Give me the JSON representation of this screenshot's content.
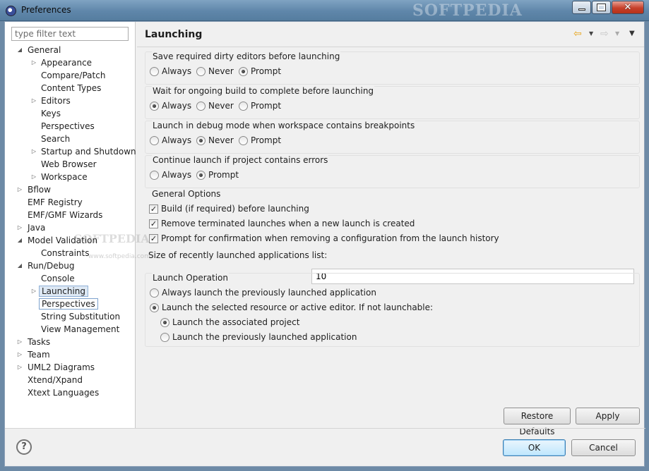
{
  "window": {
    "title": "Preferences",
    "watermark": "SOFTPEDIA",
    "controls": {
      "minimize": "minimize",
      "maximize": "maximize",
      "close": "✕"
    }
  },
  "sidebar": {
    "filter_placeholder": "type filter text",
    "tree": [
      {
        "label": "General",
        "level": 0,
        "arrow": "◢"
      },
      {
        "label": "Appearance",
        "level": 1,
        "arrow": "▷"
      },
      {
        "label": "Compare/Patch",
        "level": 1,
        "arrow": ""
      },
      {
        "label": "Content Types",
        "level": 1,
        "arrow": ""
      },
      {
        "label": "Editors",
        "level": 1,
        "arrow": "▷"
      },
      {
        "label": "Keys",
        "level": 1,
        "arrow": ""
      },
      {
        "label": "Perspectives",
        "level": 1,
        "arrow": ""
      },
      {
        "label": "Search",
        "level": 1,
        "arrow": ""
      },
      {
        "label": "Startup and Shutdown",
        "level": 1,
        "arrow": "▷"
      },
      {
        "label": "Web Browser",
        "level": 1,
        "arrow": ""
      },
      {
        "label": "Workspace",
        "level": 1,
        "arrow": "▷"
      },
      {
        "label": "Bflow",
        "level": 0,
        "arrow": "▷"
      },
      {
        "label": "EMF Registry",
        "level": 0,
        "arrow": ""
      },
      {
        "label": "EMF/GMF Wizards",
        "level": 0,
        "arrow": ""
      },
      {
        "label": "Java",
        "level": 0,
        "arrow": "▷"
      },
      {
        "label": "Model Validation",
        "level": 0,
        "arrow": "◢"
      },
      {
        "label": "Constraints",
        "level": 1,
        "arrow": ""
      },
      {
        "label": "Run/Debug",
        "level": 0,
        "arrow": "◢"
      },
      {
        "label": "Console",
        "level": 1,
        "arrow": ""
      },
      {
        "label": "Launching",
        "level": 1,
        "arrow": "▷",
        "state": "selected"
      },
      {
        "label": "Perspectives",
        "level": 1,
        "arrow": "",
        "state": "focused"
      },
      {
        "label": "String Substitution",
        "level": 1,
        "arrow": ""
      },
      {
        "label": "View Management",
        "level": 1,
        "arrow": ""
      },
      {
        "label": "Tasks",
        "level": 0,
        "arrow": "▷"
      },
      {
        "label": "Team",
        "level": 0,
        "arrow": "▷"
      },
      {
        "label": "UML2 Diagrams",
        "level": 0,
        "arrow": "▷"
      },
      {
        "label": "Xtend/Xpand",
        "level": 0,
        "arrow": ""
      },
      {
        "label": "Xtext Languages",
        "level": 0,
        "arrow": ""
      }
    ]
  },
  "page": {
    "title": "Launching",
    "nav": {
      "back_icon": "⇦",
      "forward_icon": "⇨",
      "dropdown_icon": "▼",
      "menu_icon": "▼"
    },
    "save_dirty": {
      "title": "Save required dirty editors before launching",
      "options": [
        "Always",
        "Never",
        "Prompt"
      ],
      "selected": "Prompt"
    },
    "wait_build": {
      "title": "Wait for ongoing build to complete before launching",
      "options": [
        "Always",
        "Never",
        "Prompt"
      ],
      "selected": "Always"
    },
    "debug_mode": {
      "title": "Launch in debug mode when workspace contains breakpoints",
      "options": [
        "Always",
        "Never",
        "Prompt"
      ],
      "selected": "Never"
    },
    "continue_errors": {
      "title": "Continue launch if project contains errors",
      "options": [
        "Always",
        "Prompt"
      ],
      "selected": "Prompt"
    },
    "general_options": {
      "title": "General Options",
      "build_before": "Build (if required) before launching",
      "remove_terminated": "Remove terminated launches when a new launch is created",
      "prompt_confirm": "Prompt for confirmation when removing a configuration from the launch history",
      "checked": [
        true,
        true,
        true
      ],
      "size_label": "Size of recently launched applications list:",
      "size_value": "10"
    },
    "launch_operation": {
      "title": "Launch Operation",
      "always_previous": "Always launch the previously launched application",
      "launch_selected": "Launch the selected resource or active editor. If not launchable:",
      "launch_associated": "Launch the associated project",
      "launch_previous": "Launch the previously launched application",
      "selected_main": "launch_selected",
      "selected_sub": "launch_associated"
    },
    "buttons": {
      "restore_defaults": "Restore Defaults",
      "apply": "Apply"
    }
  },
  "footer": {
    "help_icon": "?",
    "ok": "OK",
    "cancel": "Cancel"
  },
  "overlay": {
    "watermark": "SOFTPEDIA",
    "watermark_url": "www.softpedia.com"
  },
  "colors": {
    "selection_bg": "#dde8f4",
    "selection_border": "#8fb0d6",
    "default_button": "#3c7fb1",
    "title_bar": "#5f86aa"
  }
}
